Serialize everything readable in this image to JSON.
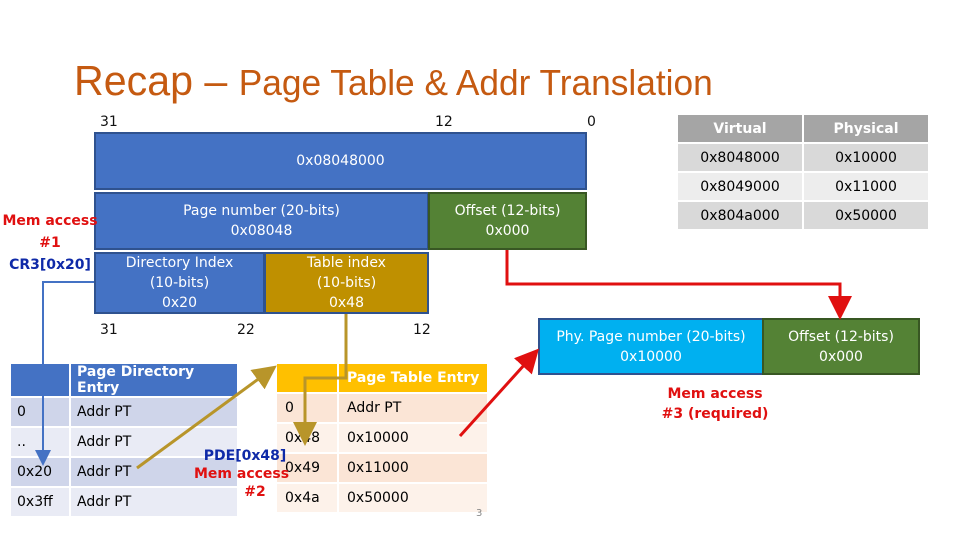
{
  "title": {
    "main": "Recap –",
    "rest": "Page Table & Addr Translation"
  },
  "bit_labels": {
    "top": [
      "31",
      "12",
      "0"
    ],
    "bottom": [
      "31",
      "22",
      "12"
    ]
  },
  "virtual_address": {
    "value": "0x08048000"
  },
  "page_number": {
    "label": "Page number (20-bits)",
    "value": "0x08048"
  },
  "offset": {
    "label": "Offset (12-bits)",
    "value": "0x000"
  },
  "directory_index": {
    "label": "Directory Index",
    "bits": "(10-bits)",
    "value": "0x20"
  },
  "table_index": {
    "label": "Table index",
    "bits": "(10-bits)",
    "value": "0x48"
  },
  "mem_access_1": {
    "line1": "Mem access",
    "line2": "#1",
    "cr3": "CR3[0x20]"
  },
  "mem_access_2": {
    "pde": "PDE[0x48]",
    "line1": "Mem access",
    "line2": "#2"
  },
  "mem_access_3": {
    "line1": "Mem access",
    "line2": "#3 (required)"
  },
  "physical_address": {
    "page_label": "Phy. Page number (20-bits)",
    "page_value": "0x10000",
    "offset_label": "Offset (12-bits)",
    "offset_value": "0x000"
  },
  "mapping_table": {
    "headers": [
      "Virtual",
      "Physical"
    ],
    "rows": [
      [
        "0x8048000",
        "0x10000"
      ],
      [
        "0x8049000",
        "0x11000"
      ],
      [
        "0x804a000",
        "0x50000"
      ]
    ]
  },
  "page_directory": {
    "headers": [
      "",
      "Page Directory Entry"
    ],
    "rows": [
      [
        "0",
        "Addr PT"
      ],
      [
        "..",
        "Addr PT"
      ],
      [
        "0x20",
        "Addr PT"
      ],
      [
        "0x3ff",
        "Addr PT"
      ]
    ]
  },
  "page_table": {
    "headers": [
      "",
      "Page Table Entry"
    ],
    "rows": [
      [
        "0",
        "Addr PT"
      ],
      [
        "0x48",
        "0x10000"
      ],
      [
        "0x49",
        "0x11000"
      ],
      [
        "0x4a",
        "0x50000"
      ]
    ]
  },
  "slide_number": "3",
  "colors": {
    "title": "#c55a11",
    "blue": "#4472c4",
    "green": "#548235",
    "gold": "#bf9000",
    "cyan": "#00b0f0",
    "red": "#e01010",
    "dark_blue": "#0f2aa8"
  }
}
